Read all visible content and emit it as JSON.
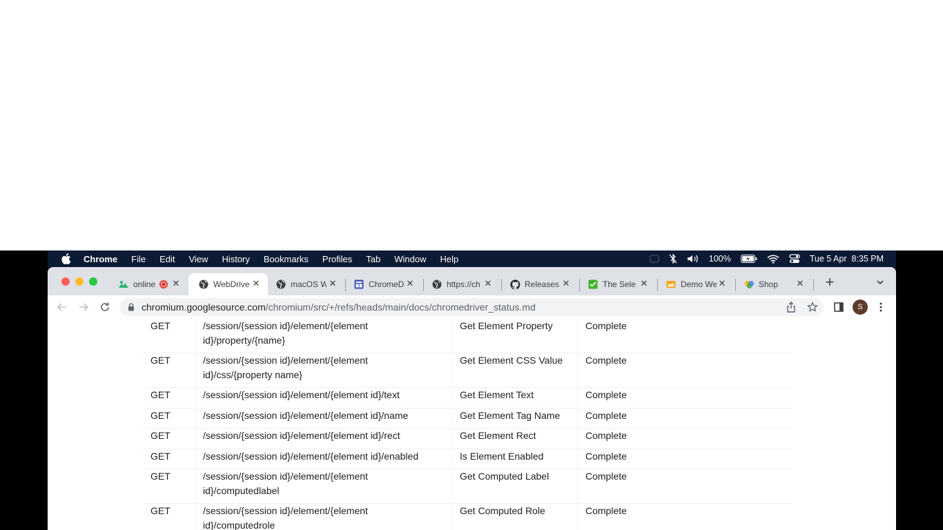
{
  "menubar": {
    "app": "Chrome",
    "items": [
      "File",
      "Edit",
      "View",
      "History",
      "Bookmarks",
      "Profiles",
      "Tab",
      "Window",
      "Help"
    ],
    "battery": "100%",
    "datetime": "Tue 5 Apr  8:35 PM"
  },
  "tabs": [
    {
      "title": "online",
      "icon": "online-recording-icon"
    },
    {
      "title": "WebDrive",
      "icon": "globe-icon",
      "active": true
    },
    {
      "title": "macOS W",
      "icon": "globe-icon"
    },
    {
      "title": "ChromeD",
      "icon": "chromedriver-page-icon"
    },
    {
      "title": "https://ch",
      "icon": "globe-icon"
    },
    {
      "title": "Releases",
      "icon": "github-icon"
    },
    {
      "title": "The Sele",
      "icon": "selenium-icon"
    },
    {
      "title": "Demo We",
      "icon": "demo-site-icon"
    },
    {
      "title": "Shop",
      "icon": "shop-icon"
    }
  ],
  "url": {
    "host": "chromium.googlesource.com",
    "path": "/chromium/src/+/refs/heads/main/docs/chromedriver_status.md"
  },
  "profile_initial": "S",
  "table": {
    "rows": [
      {
        "method": "GET",
        "path_line1": "/session/{session id}/element/{element",
        "path_line2": "id}/property/{name}",
        "command": "Get Element Property",
        "status": "Complete"
      },
      {
        "method": "GET",
        "path_line1": "/session/{session id}/element/{element",
        "path_line2": "id}/css/{property name}",
        "command": "Get Element CSS Value",
        "status": "Complete"
      },
      {
        "method": "GET",
        "path_line1": "/session/{session id}/element/{element id}/text",
        "path_line2": "",
        "command": "Get Element Text",
        "status": "Complete"
      },
      {
        "method": "GET",
        "path_line1": "/session/{session id}/element/{element id}/name",
        "path_line2": "",
        "command": "Get Element Tag Name",
        "status": "Complete"
      },
      {
        "method": "GET",
        "path_line1": "/session/{session id}/element/{element id}/rect",
        "path_line2": "",
        "command": "Get Element Rect",
        "status": "Complete"
      },
      {
        "method": "GET",
        "path_line1": "/session/{session id}/element/{element id}/enabled",
        "path_line2": "",
        "command": "Is Element Enabled",
        "status": "Complete"
      },
      {
        "method": "GET",
        "path_line1": "/session/{session id}/element/{element",
        "path_line2": "id}/computedlabel",
        "command": "Get Computed Label",
        "status": "Complete"
      },
      {
        "method": "GET",
        "path_line1": "/session/{session id}/element/{element",
        "path_line2": "id}/computedrole",
        "command": "Get Computed Role",
        "status": "Complete"
      }
    ]
  },
  "colors": {
    "menubar_bg": "#0d1a33",
    "tabstrip_bg": "#dee1e6",
    "close_red": "#ff5f57",
    "minimize_yellow": "#febc2e",
    "zoom_green": "#28c840"
  }
}
